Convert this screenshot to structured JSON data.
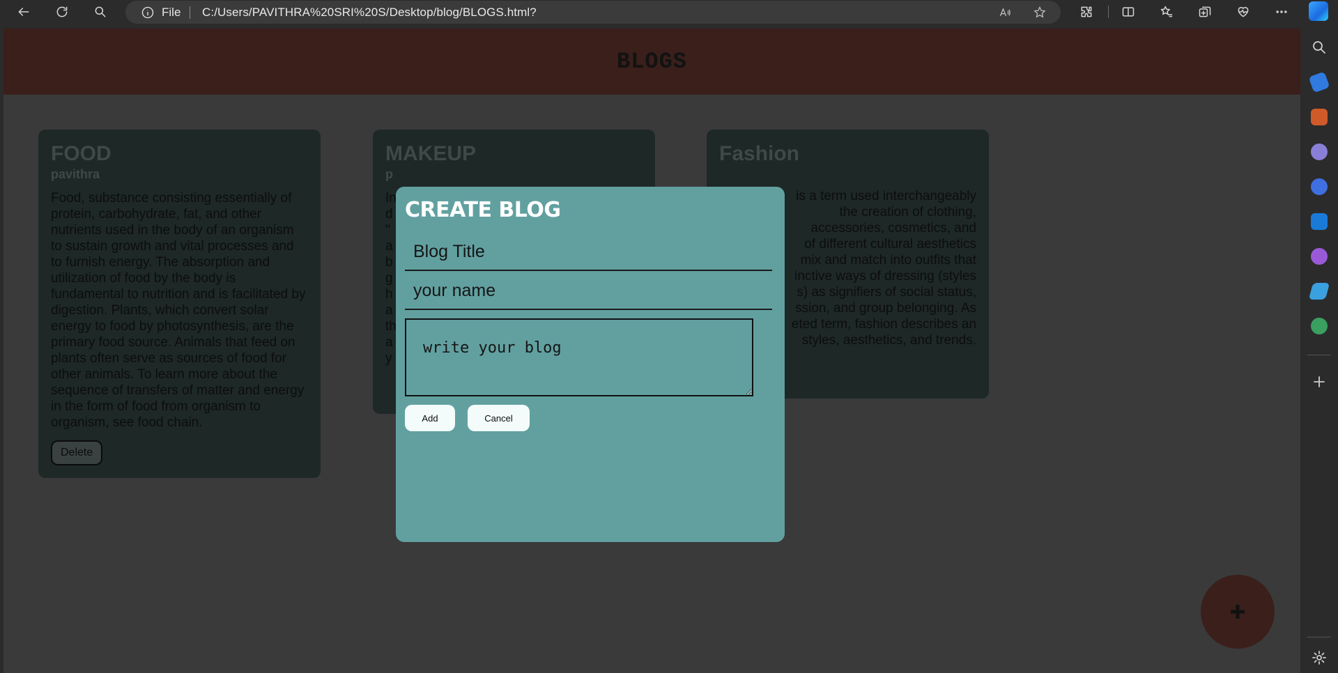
{
  "browser": {
    "address_file_label": "File",
    "url": "C:/Users/PAVITHRA%20SRI%20S/Desktop/blog/BLOGS.html?"
  },
  "page": {
    "title": "BLOGS"
  },
  "cards": [
    {
      "title": "FOOD",
      "author": "pavithra",
      "body": "Food, substance consisting essentially of protein, carbohydrate, fat, and other nutrients used in the body of an organism to sustain growth and vital processes and to furnish energy. The absorption and utilization of food by the body is fundamental to nutrition and is facilitated by digestion. Plants, which convert solar energy to food by photosynthesis, are the primary food source. Animals that feed on plants often serve as sources of food for other animals. To learn more about the sequence of transfers of matter and energy in the form of food from organism to organism, see food chain.",
      "delete_label": "Delete"
    },
    {
      "title": "MAKEUP",
      "author": "p",
      "body": "In\nd\n\"\na\nb\ng\nh\na\nth\na\ny",
      "delete_label": ""
    },
    {
      "title": "Fashion",
      "author": "",
      "body": "is a term used interchangeably\nthe creation of clothing,\naccessories, cosmetics, and\nof different cultural aesthetics\nmix and match into outfits that\ninctive ways of dressing (styles\ns) as signifiers of social status,\nssion, and group belonging. As\neted term, fashion describes an\nstyles, aesthetics, and trends.",
      "delete_label": ""
    }
  ],
  "modal": {
    "title": "CREATE BLOG",
    "title_placeholder": "Blog Title",
    "name_placeholder": "your name",
    "blog_placeholder": "write your blog",
    "add_label": "Add",
    "cancel_label": "Cancel"
  },
  "fab": {
    "icon": "plus-icon"
  }
}
